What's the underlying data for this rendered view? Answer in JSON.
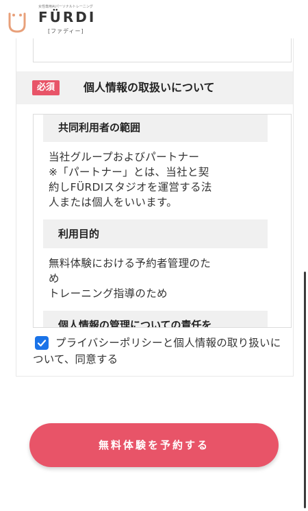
{
  "header": {
    "tagline": "女性専用AIパーソナルトレーニング",
    "logo_text": "FÜRDI",
    "logo_sub": "[ファディー]"
  },
  "privacy_section": {
    "required_badge": "必須",
    "title": "個人情報の取扱いについて",
    "blocks": [
      {
        "heading": "共同利用者の範囲",
        "lines": [
          "当社グループおよびパートナー",
          "※「パートナー」とは、当社と契",
          "約しFÜRDIスタジオを運営する法",
          "人または個人をいいます。"
        ]
      },
      {
        "heading": "利用目的",
        "lines": [
          "無料体験における予約者管理のた",
          "め",
          "トレーニング指導のため"
        ]
      },
      {
        "heading": "個人情報の管理についての責任を",
        "lines": []
      }
    ]
  },
  "agreement": {
    "checked": true,
    "label": "プライバシーポリシーと個人情報の取り扱いについて、同意する"
  },
  "cta": {
    "label": "無料体験を予約する"
  },
  "colors": {
    "accent": "#e85468",
    "checkbox": "#1a73e8",
    "section_bg": "#f1f1f1"
  }
}
